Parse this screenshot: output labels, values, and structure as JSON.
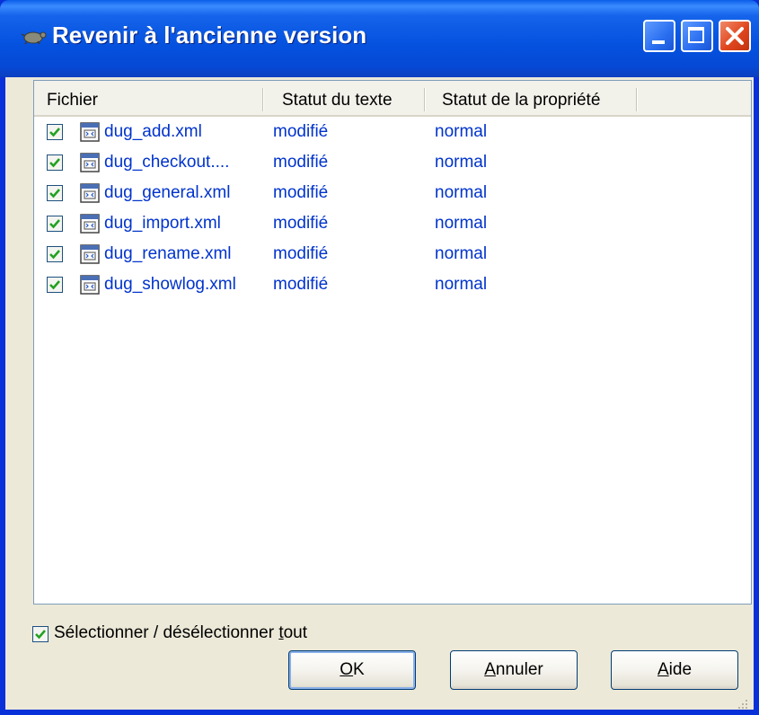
{
  "window": {
    "title": "Revenir à l'ancienne version",
    "controls": [
      "minimize",
      "maximize",
      "close"
    ]
  },
  "list": {
    "columns": [
      "Fichier",
      "Statut du texte",
      "Statut de la propriété"
    ],
    "rows": [
      {
        "checked": true,
        "file": "dug_add.xml",
        "text_status": "modifié",
        "prop_status": "normal"
      },
      {
        "checked": true,
        "file": "dug_checkout....",
        "text_status": "modifié",
        "prop_status": "normal"
      },
      {
        "checked": true,
        "file": "dug_general.xml",
        "text_status": "modifié",
        "prop_status": "normal"
      },
      {
        "checked": true,
        "file": "dug_import.xml",
        "text_status": "modifié",
        "prop_status": "normal"
      },
      {
        "checked": true,
        "file": "dug_rename.xml",
        "text_status": "modifié",
        "prop_status": "normal"
      },
      {
        "checked": true,
        "file": "dug_showlog.xml",
        "text_status": "modifié",
        "prop_status": "normal"
      }
    ]
  },
  "select_all": {
    "checked": true,
    "label": "Sélectionner / désélectionner tout"
  },
  "buttons": {
    "ok": "OK",
    "cancel": "Annuler",
    "help": "Aide"
  },
  "colors": {
    "titlebar": "#0553e0",
    "dialog_bg": "#ece9d8",
    "row_text": "#0033cc",
    "check": "#21a121"
  },
  "icons": {
    "app": "tortoise-svn-icon",
    "file": "xml-file-icon",
    "check": "checkmark-icon"
  }
}
